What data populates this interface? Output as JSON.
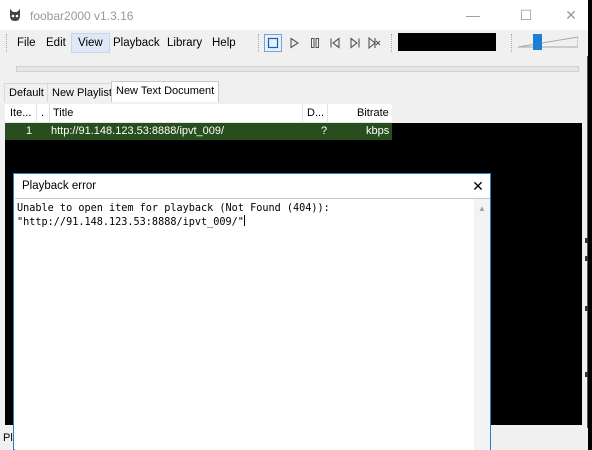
{
  "window": {
    "title": "foobar2000 v1.3.16",
    "minimize": "—",
    "maximize": "☐",
    "close": "✕"
  },
  "menu": [
    "File",
    "Edit",
    "View",
    "Playback",
    "Library",
    "Help"
  ],
  "menu_active": "View",
  "controls": [
    "stop-icon",
    "play-icon",
    "pause-icon",
    "previous-icon",
    "next-icon",
    "random-icon"
  ],
  "tabs": [
    "Default",
    "New Playlist",
    "New Text Document"
  ],
  "selected_tab": "New Text Document",
  "playlist": {
    "columns": {
      "item": "Ite...",
      "dot": ".",
      "title": "Title",
      "duration": "D...",
      "bitrate": "Bitrate"
    },
    "rows": [
      {
        "item": "1",
        "title": "http://91.148.123.53:8888/ipvt_009/",
        "duration": "?",
        "bitrate": "kbps"
      }
    ],
    "selected_row_color": "#274e1c"
  },
  "status": {
    "text": "Pl"
  },
  "dialog": {
    "title": "Playback error",
    "close": "✕",
    "line1": "Unable to open item for playback (Not Found (404)):",
    "line2": "\"http://91.148.123.53:8888/ipvt_009/\"",
    "accent": "#1f80d0"
  }
}
